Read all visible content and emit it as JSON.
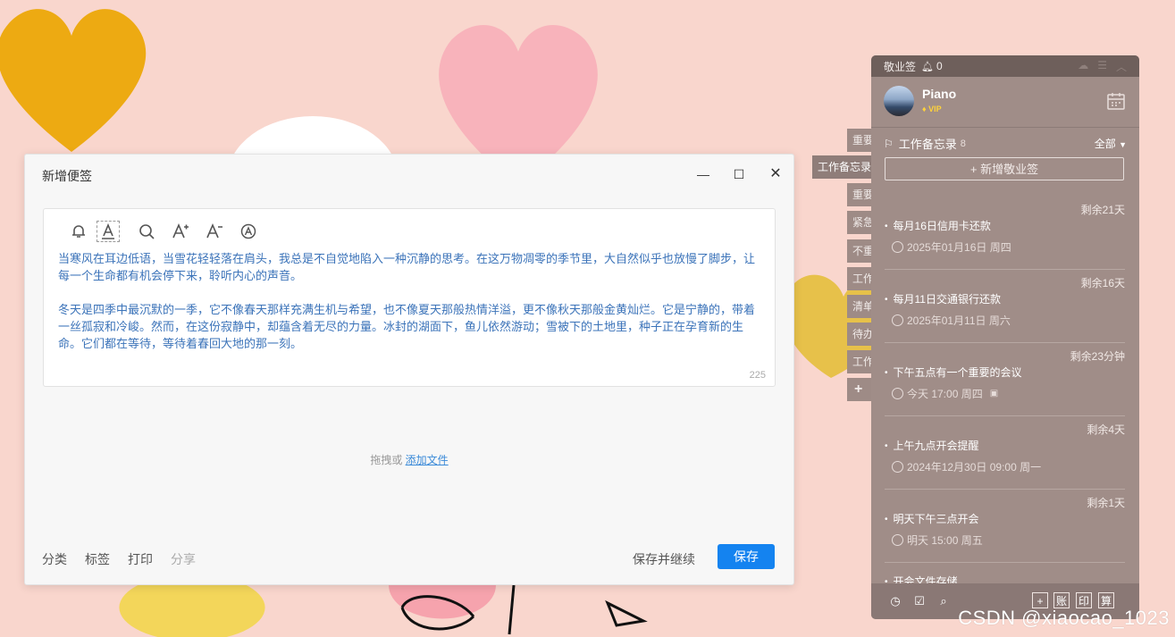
{
  "editor": {
    "title": "新增便签",
    "content_p1": "当寒风在耳边低语，当雪花轻轻落在肩头，我总是不自觉地陷入一种沉静的思考。在这万物凋零的季节里，大自然似乎也放慢了脚步，让每一个生命都有机会停下来，聆听内心的声音。",
    "content_p2": "冬天是四季中最沉默的一季，它不像春天那样充满生机与希望，也不像夏天那般热情洋溢，更不像秋天那般金黄灿烂。它是宁静的，带着一丝孤寂和冷峻。然而，在这份寂静中，却蕴含着无尽的力量。冰封的湖面下，鱼儿依然游动；雪被下的土地里，种子正在孕育新的生命。它们都在等待，等待着春回大地的那一刻。",
    "char_count": "225",
    "drop_text": "拖拽或",
    "add_file": "添加文件",
    "footer": {
      "category": "分类",
      "tag": "标签",
      "print": "打印",
      "share": "分享",
      "save_continue": "保存并继续",
      "save": "保存"
    }
  },
  "side_tabs": [
    "重要",
    "工作备忘录",
    "重要",
    "紧急",
    "不重",
    "工作",
    "清单",
    "待办",
    "工作",
    "+"
  ],
  "panel": {
    "app_name": "敬业签",
    "bell_count": "0",
    "username": "Piano",
    "vip": "VIP",
    "category": "工作备忘录",
    "category_count": "8",
    "filter": "全部",
    "add_label": "新增敬业签",
    "items": [
      {
        "remain": "剩余21天",
        "title": "每月16日信用卡还款",
        "meta": "2025年01月16日 周四"
      },
      {
        "remain": "剩余16天",
        "title": "每月11日交通银行还款",
        "meta": "2025年01月11日 周六"
      },
      {
        "remain": "剩余23分钟",
        "title": "下午五点有一个重要的会议",
        "meta": "今天 17:00 周四"
      },
      {
        "remain": "剩余4天",
        "title": "上午九点开会提醒",
        "meta": "2024年12月30日 09:00 周一"
      },
      {
        "remain": "剩余1天",
        "title": "明天下午三点开会",
        "meta": "明天 15:00 周五"
      }
    ],
    "last_item": "开会文件存储",
    "footer_boxes": [
      "账",
      "印",
      "算"
    ]
  },
  "watermark": "CSDN @xiaocao_1023",
  "colors": {
    "accent": "#1483f0",
    "panel_bg": "#a08d88",
    "content_text": "#3b73b9"
  }
}
